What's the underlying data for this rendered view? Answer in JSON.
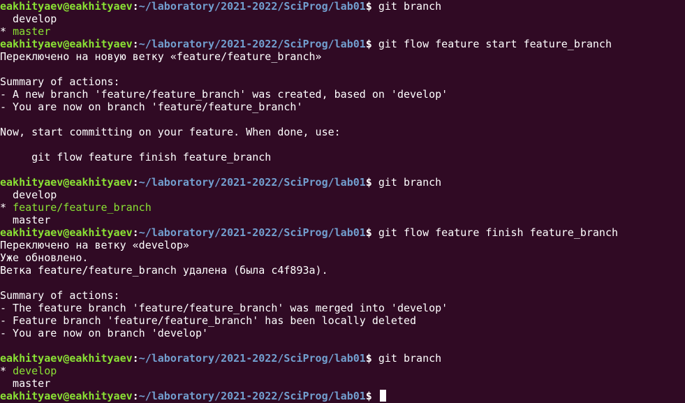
{
  "prompt": {
    "user": "eakhityaev@eakhityaev",
    "sep": ":",
    "path": "~/laboratory/2021-2022/SciProg/lab01",
    "symbol": "$"
  },
  "lines": [
    {
      "type": "prompt",
      "cmd": "git branch"
    },
    {
      "type": "text",
      "text": "  develop"
    },
    {
      "type": "branch-current",
      "star": "* ",
      "text": "master"
    },
    {
      "type": "prompt",
      "cmd": "git flow feature start feature_branch"
    },
    {
      "type": "text",
      "text": "Переключено на новую ветку «feature/feature_branch»"
    },
    {
      "type": "text",
      "text": ""
    },
    {
      "type": "text",
      "text": "Summary of actions:"
    },
    {
      "type": "text",
      "text": "- A new branch 'feature/feature_branch' was created, based on 'develop'"
    },
    {
      "type": "text",
      "text": "- You are now on branch 'feature/feature_branch'"
    },
    {
      "type": "text",
      "text": ""
    },
    {
      "type": "text",
      "text": "Now, start committing on your feature. When done, use:"
    },
    {
      "type": "text",
      "text": ""
    },
    {
      "type": "text",
      "text": "     git flow feature finish feature_branch"
    },
    {
      "type": "text",
      "text": ""
    },
    {
      "type": "prompt",
      "cmd": "git branch"
    },
    {
      "type": "text",
      "text": "  develop"
    },
    {
      "type": "branch-current",
      "star": "* ",
      "text": "feature/feature_branch"
    },
    {
      "type": "text",
      "text": "  master"
    },
    {
      "type": "prompt",
      "cmd": "git flow feature finish feature_branch"
    },
    {
      "type": "text",
      "text": "Переключено на ветку «develop»"
    },
    {
      "type": "text",
      "text": "Уже обновлено."
    },
    {
      "type": "text",
      "text": "Ветка feature/feature_branch удалена (была c4f893a)."
    },
    {
      "type": "text",
      "text": ""
    },
    {
      "type": "text",
      "text": "Summary of actions:"
    },
    {
      "type": "text",
      "text": "- The feature branch 'feature/feature_branch' was merged into 'develop'"
    },
    {
      "type": "text",
      "text": "- Feature branch 'feature/feature_branch' has been locally deleted"
    },
    {
      "type": "text",
      "text": "- You are now on branch 'develop'"
    },
    {
      "type": "text",
      "text": ""
    },
    {
      "type": "prompt",
      "cmd": "git branch"
    },
    {
      "type": "branch-current",
      "star": "* ",
      "text": "develop"
    },
    {
      "type": "text",
      "text": "  master"
    },
    {
      "type": "prompt",
      "cmd": "",
      "cursor": true
    }
  ],
  "colors": {
    "background": "#300a24",
    "user": "#8ae234",
    "path": "#729fcf",
    "text": "#ffffff"
  }
}
